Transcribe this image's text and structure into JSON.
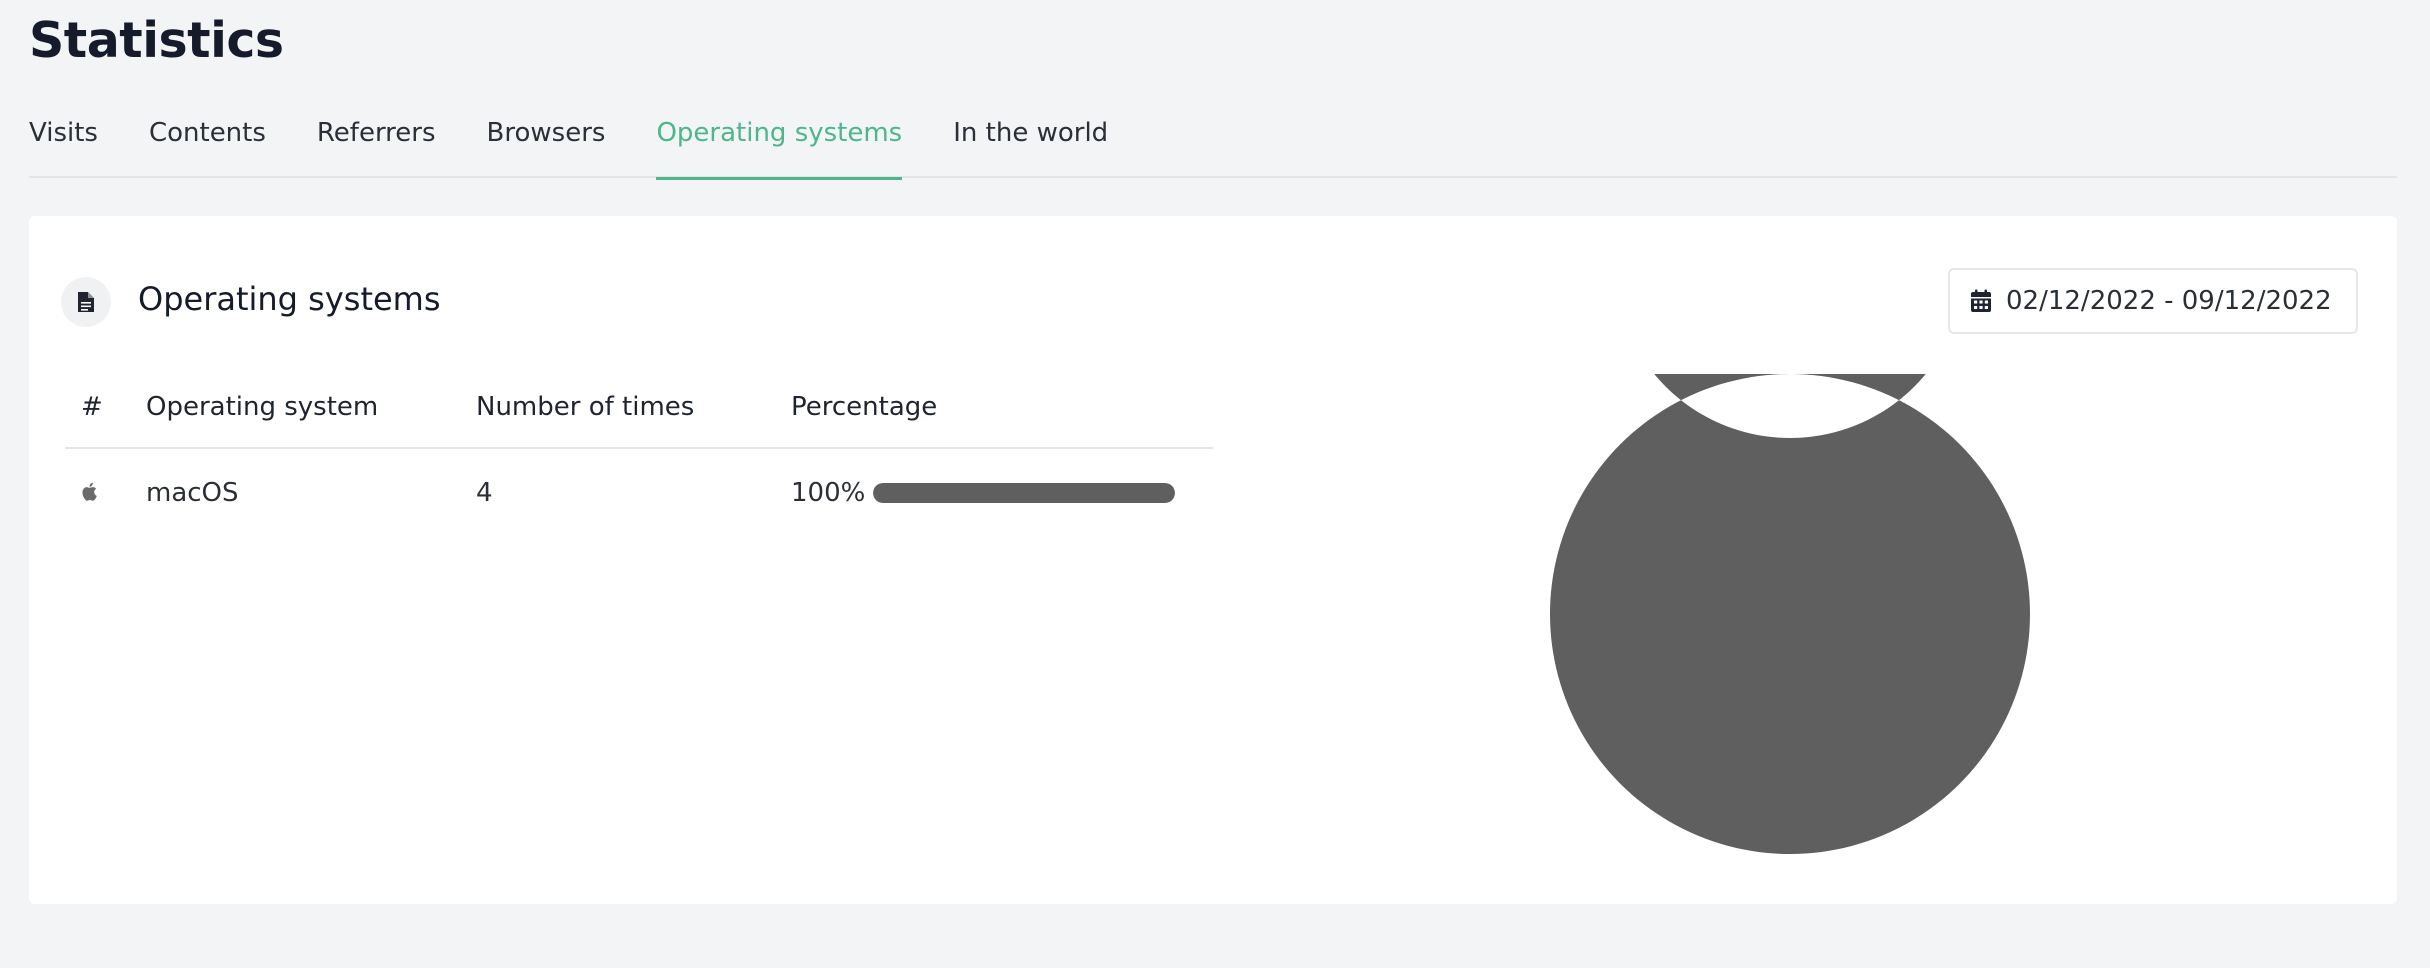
{
  "page_title": "Statistics",
  "tabs": [
    {
      "label": "Visits",
      "active": false
    },
    {
      "label": "Contents",
      "active": false
    },
    {
      "label": "Referrers",
      "active": false
    },
    {
      "label": "Browsers",
      "active": false
    },
    {
      "label": "Operating systems",
      "active": true
    },
    {
      "label": "In the world",
      "active": false
    }
  ],
  "card": {
    "icon": "document-icon",
    "title": "Operating systems",
    "date_range": "02/12/2022 - 09/12/2022",
    "date_icon": "calendar-icon"
  },
  "table": {
    "columns": [
      "#",
      "Operating system",
      "Number of times",
      "Percentage"
    ],
    "rows": [
      {
        "icon": "apple-icon",
        "os": "macOS",
        "count": "4",
        "percentage": "100%",
        "fraction": 1.0
      }
    ]
  },
  "colors": {
    "accent": "#4fb68c",
    "bar": "#5f5f5f",
    "background": "#f3f4f6"
  },
  "chart_data": {
    "type": "pie",
    "variant": "donut",
    "categories": [
      "macOS"
    ],
    "values": [
      4
    ],
    "colors": [
      "#5f5f5f"
    ]
  }
}
